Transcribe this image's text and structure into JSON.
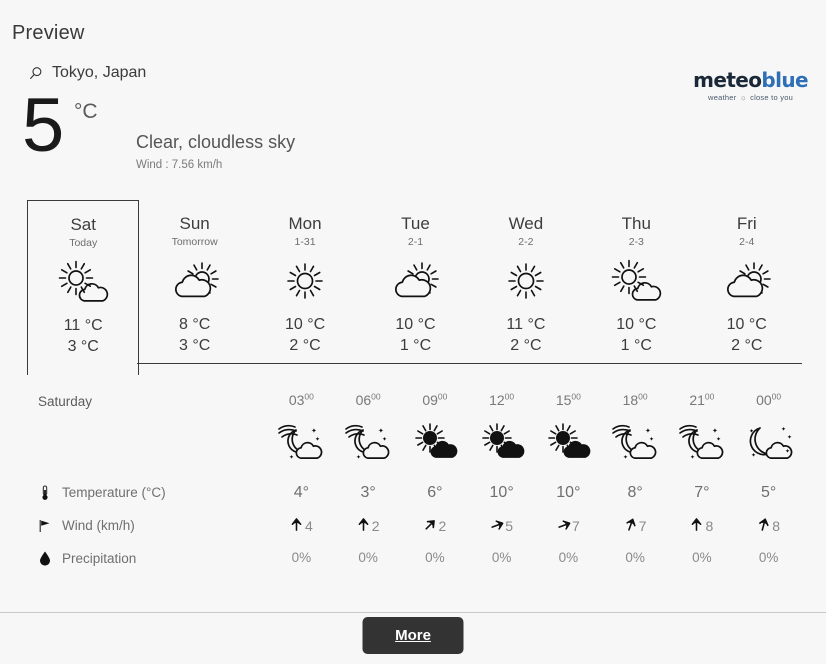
{
  "page": {
    "title": "Preview",
    "background": "#f7f7f7"
  },
  "brand": {
    "name_part1": "meteo",
    "name_part2": "blue",
    "tagline_left": "weather",
    "tagline_right": "close to you",
    "tagline_icon": "sun-icon",
    "accent": "#2f6fb5"
  },
  "location": {
    "icon": "search-icon",
    "name": "Tokyo, Japan"
  },
  "current": {
    "temperature": "5",
    "unit": "°C",
    "condition": "Clear, cloudless sky",
    "wind": "Wind : 7.56 km/h"
  },
  "daily": {
    "days": [
      {
        "name": "Sat",
        "sub": "Today",
        "icon": "sun-cloud-icon",
        "max": "11 °C",
        "min": "3 °C",
        "active": true
      },
      {
        "name": "Sun",
        "sub": "Tomorrow",
        "icon": "cloud-sun-icon",
        "max": "8 °C",
        "min": "3 °C",
        "active": false
      },
      {
        "name": "Mon",
        "sub": "1-31",
        "icon": "sun-icon",
        "max": "10 °C",
        "min": "2 °C",
        "active": false
      },
      {
        "name": "Tue",
        "sub": "2-1",
        "icon": "cloud-sun-icon",
        "max": "10 °C",
        "min": "1 °C",
        "active": false
      },
      {
        "name": "Wed",
        "sub": "2-2",
        "icon": "sun-icon",
        "max": "11 °C",
        "min": "2 °C",
        "active": false
      },
      {
        "name": "Thu",
        "sub": "2-3",
        "icon": "sun-cloud-icon",
        "max": "10 °C",
        "min": "1 °C",
        "active": false
      },
      {
        "name": "Fri",
        "sub": "2-4",
        "icon": "cloud-sun-icon",
        "max": "10 °C",
        "min": "2 °C",
        "active": false
      }
    ]
  },
  "hourly": {
    "day_label": "Saturday",
    "times": [
      "03",
      "06",
      "09",
      "12",
      "15",
      "18",
      "21",
      "00"
    ],
    "time_suffix": "00",
    "icons": [
      "night-cloud-stars-icon",
      "night-cloud-stars-icon",
      "sun-cloud-filled-icon",
      "sun-cloud-filled-icon",
      "sun-cloud-filled-icon",
      "night-cloud-stars-icon",
      "night-cloud-stars-icon",
      "moon-cloud-stars-icon"
    ],
    "rows": {
      "temperature": {
        "icon": "thermometer-icon",
        "label": "Temperature (°C)",
        "values": [
          "4°",
          "3°",
          "6°",
          "10°",
          "10°",
          "8°",
          "7°",
          "5°"
        ]
      },
      "wind": {
        "icon": "flag-icon",
        "label": "Wind (km/h)",
        "values": [
          "4",
          "2",
          "2",
          "5",
          "7",
          "7",
          "8",
          "8"
        ],
        "directions": [
          180,
          180,
          225,
          250,
          250,
          200,
          180,
          195
        ]
      },
      "precipitation": {
        "icon": "droplet-icon",
        "label": "Precipitation",
        "values": [
          "0%",
          "0%",
          "0%",
          "0%",
          "0%",
          "0%",
          "0%",
          "0%"
        ]
      }
    }
  },
  "footer": {
    "more_label": "More"
  }
}
